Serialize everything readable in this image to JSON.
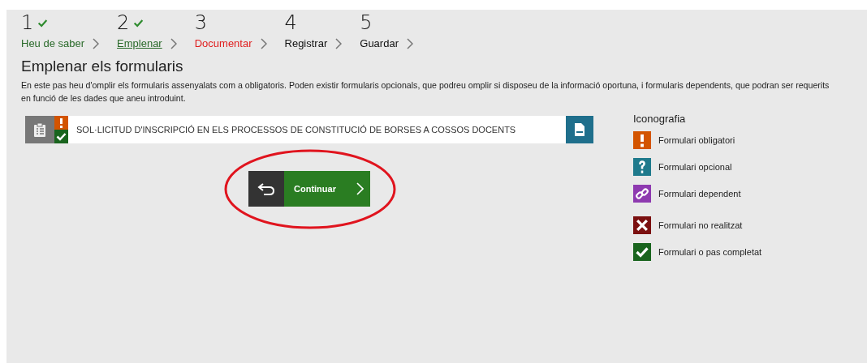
{
  "steps": [
    {
      "number": "1",
      "label": "Heu de saber",
      "kind": "done",
      "selected": false
    },
    {
      "number": "2",
      "label": "Emplenar",
      "kind": "done",
      "selected": true
    },
    {
      "number": "3",
      "label": "Documentar",
      "kind": "error",
      "selected": false
    },
    {
      "number": "4",
      "label": "Registrar",
      "kind": "pending",
      "selected": false
    },
    {
      "number": "5",
      "label": "Guardar",
      "kind": "pending",
      "selected": false
    }
  ],
  "heading": "Emplenar els formularis",
  "description": "En este pas heu d'omplir els formularis assenyalats com a obligatoris. Poden existir formularis opcionals, que podreu omplir si disposeu de la informació oportuna, i formularis dependents, que podran ser requerits en funció de les dades que aneu introduint.",
  "forms": [
    {
      "title": "SOL·LICITUD D'INSCRIPCIÓ EN ELS PROCESSOS DE CONSTITUCIÓ DE BORSES A COSSOS DOCENTS",
      "badges": [
        {
          "kind": "mandatory"
        },
        {
          "kind": "completed"
        }
      ]
    }
  ],
  "continue_button": {
    "label": "Continuar",
    "highlighted": true
  },
  "legend": {
    "title": "Iconografia",
    "items": [
      {
        "kind": "mandatory",
        "label": "Formulari obligatori"
      },
      {
        "kind": "optional",
        "label": "Formulari opcional"
      },
      {
        "kind": "dependent",
        "label": "Formulari dependent"
      },
      {
        "kind": "not-done",
        "label": "Formulari no realitzat"
      },
      {
        "kind": "completed",
        "label": "Formulari o pas completat"
      }
    ]
  }
}
